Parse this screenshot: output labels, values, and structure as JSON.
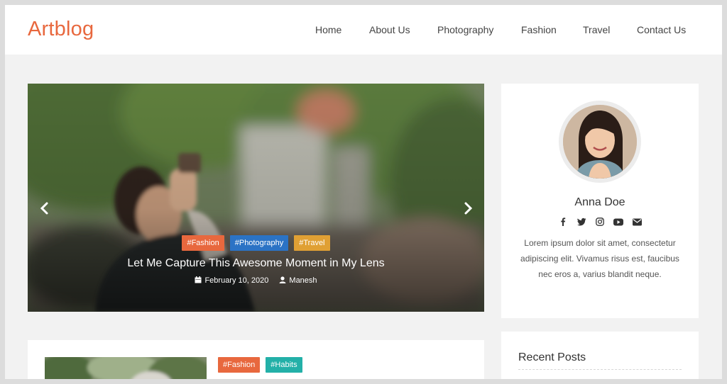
{
  "header": {
    "logo": "Artblog",
    "nav": [
      {
        "label": "Home"
      },
      {
        "label": "About Us"
      },
      {
        "label": "Photography"
      },
      {
        "label": "Fashion"
      },
      {
        "label": "Travel"
      },
      {
        "label": "Contact Us"
      }
    ]
  },
  "slider": {
    "prev_icon": "chevron-left-icon",
    "next_icon": "chevron-right-icon",
    "tags": [
      {
        "label": "#Fashion",
        "color": "#e8683e"
      },
      {
        "label": "#Photography",
        "color": "#2b73c5"
      },
      {
        "label": "#Travel",
        "color": "#e0a034"
      }
    ],
    "title": "Let Me Capture This Awesome Moment in My Lens",
    "date": "February 10, 2020",
    "author": "Manesh"
  },
  "profile": {
    "name": "Anna Doe",
    "socials": [
      "facebook-icon",
      "twitter-icon",
      "instagram-icon",
      "youtube-icon",
      "email-icon"
    ],
    "bio": "Lorem ipsum dolor sit amet, consectetur adipiscing elit. Vivamus risus est, faucibus nec eros a, varius blandit neque."
  },
  "post": {
    "tags": [
      {
        "label": "#Fashion",
        "color": "#e8683e"
      },
      {
        "label": "#Habits",
        "color": "#23b0a8"
      }
    ]
  },
  "recent": {
    "title": "Recent Posts"
  }
}
